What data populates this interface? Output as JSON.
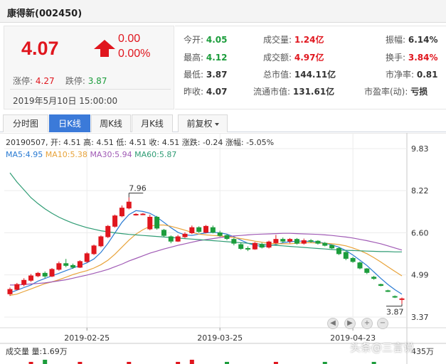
{
  "stock": {
    "title": "康得新(002450)"
  },
  "quote": {
    "price": "4.07",
    "change": "0.00",
    "change_pct": "0.00%",
    "limit_up_label": "涨停:",
    "limit_up": "4.27",
    "limit_down_label": "跌停:",
    "limit_down": "3.87",
    "datetime": "2019年5月10日 15:00:00"
  },
  "stats": [
    {
      "label": "今开:",
      "value": "4.05",
      "color": "green"
    },
    {
      "label": "成交量:",
      "value": "1.24亿",
      "color": "red"
    },
    {
      "label": "振幅:",
      "value": "6.14%",
      "color": "dark"
    },
    {
      "label": "最高:",
      "value": "4.12",
      "color": "green"
    },
    {
      "label": "成交额:",
      "value": "4.97亿",
      "color": "red"
    },
    {
      "label": "换手:",
      "value": "3.84%",
      "color": "red"
    },
    {
      "label": "最低:",
      "value": "3.87",
      "color": "dark"
    },
    {
      "label": "总市值:",
      "value": "144.11亿",
      "color": "dark"
    },
    {
      "label": "市净率:",
      "value": "0.81",
      "color": "dark"
    },
    {
      "label": "昨收:",
      "value": "4.07",
      "color": "dark"
    },
    {
      "label": "流通市值:",
      "value": "131.61亿",
      "color": "dark"
    },
    {
      "label": "市盈率(动):",
      "value": "亏损",
      "color": "dark"
    }
  ],
  "tabs": [
    {
      "label": "分时图",
      "active": false
    },
    {
      "label": "日K线",
      "active": true
    },
    {
      "label": "周K线",
      "active": false
    },
    {
      "label": "月K线",
      "active": false
    },
    {
      "label": "前复权",
      "active": false
    }
  ],
  "chart_info": {
    "line1": "20190507, 开: 4.51 高: 4.51 低: 4.51 收: 4.51 涨跌: -0.24 涨幅: -5.05%",
    "ma5": "MA5:4.95",
    "ma10": "MA10:5.38",
    "ma30": "MA30:5.94",
    "ma60": "MA60:5.87",
    "volume": "成交量 量:1.69万"
  },
  "watermark": "头条@三言说",
  "chart_data": {
    "type": "candlestick",
    "y_ticks": [
      "9.83",
      "8.22",
      "6.60",
      "4.99",
      "3.37"
    ],
    "y_range": [
      3.37,
      9.83
    ],
    "volume_tick": "435万",
    "x_labels": [
      {
        "label": "2019-02-25",
        "index": 11
      },
      {
        "label": "2019-03-25",
        "index": 30
      },
      {
        "label": "2019-04-23",
        "index": 49
      }
    ],
    "annotations": [
      {
        "text": "7.96",
        "index": 17,
        "value": 7.96
      },
      {
        "text": "3.87",
        "index": 56,
        "value": 3.87
      }
    ],
    "candles": [
      {
        "o": 4.26,
        "c": 4.43,
        "h": 4.5,
        "l": 4.18
      },
      {
        "o": 4.43,
        "c": 4.62,
        "h": 4.68,
        "l": 4.4
      },
      {
        "o": 4.62,
        "c": 4.78,
        "h": 4.86,
        "l": 4.55
      },
      {
        "o": 4.78,
        "c": 4.95,
        "h": 5.02,
        "l": 4.72
      },
      {
        "o": 4.95,
        "c": 5.05,
        "h": 5.1,
        "l": 4.9
      },
      {
        "o": 5.05,
        "c": 4.94,
        "h": 5.12,
        "l": 4.86
      },
      {
        "o": 4.94,
        "c": 5.2,
        "h": 5.25,
        "l": 4.9
      },
      {
        "o": 5.2,
        "c": 5.42,
        "h": 5.5,
        "l": 5.15
      },
      {
        "o": 5.42,
        "c": 5.35,
        "h": 5.6,
        "l": 5.28
      },
      {
        "o": 5.35,
        "c": 5.28,
        "h": 5.42,
        "l": 5.22
      },
      {
        "o": 5.28,
        "c": 5.5,
        "h": 5.55,
        "l": 5.25
      },
      {
        "o": 5.5,
        "c": 5.8,
        "h": 5.86,
        "l": 5.45
      },
      {
        "o": 5.8,
        "c": 6.1,
        "h": 6.15,
        "l": 5.75
      },
      {
        "o": 6.1,
        "c": 6.45,
        "h": 6.5,
        "l": 6.05
      },
      {
        "o": 6.45,
        "c": 6.85,
        "h": 6.9,
        "l": 6.4
      },
      {
        "o": 6.85,
        "c": 7.25,
        "h": 7.3,
        "l": 6.8
      },
      {
        "o": 7.25,
        "c": 7.55,
        "h": 7.65,
        "l": 7.2
      },
      {
        "o": 7.55,
        "c": 7.78,
        "h": 7.96,
        "l": 7.5
      },
      {
        "o": 7.3,
        "c": 7.31,
        "h": 7.35,
        "l": 7.26
      },
      {
        "o": 7.31,
        "c": 7.32,
        "h": 7.36,
        "l": 7.28
      },
      {
        "o": 6.75,
        "c": 7.2,
        "h": 7.3,
        "l": 6.7
      },
      {
        "o": 7.2,
        "c": 6.78,
        "h": 7.25,
        "l": 6.72
      },
      {
        "o": 6.7,
        "c": 6.5,
        "h": 6.75,
        "l": 6.45
      },
      {
        "o": 6.45,
        "c": 6.28,
        "h": 6.5,
        "l": 6.2
      },
      {
        "o": 6.28,
        "c": 6.45,
        "h": 6.52,
        "l": 6.25
      },
      {
        "o": 6.45,
        "c": 6.55,
        "h": 6.62,
        "l": 6.4
      },
      {
        "o": 6.6,
        "c": 6.8,
        "h": 6.88,
        "l": 6.55
      },
      {
        "o": 6.8,
        "c": 6.65,
        "h": 6.85,
        "l": 6.6
      },
      {
        "o": 6.62,
        "c": 6.85,
        "h": 6.9,
        "l": 6.58
      },
      {
        "o": 6.8,
        "c": 6.62,
        "h": 6.88,
        "l": 6.58
      },
      {
        "o": 6.6,
        "c": 6.5,
        "h": 6.68,
        "l": 6.45
      },
      {
        "o": 6.5,
        "c": 6.38,
        "h": 6.55,
        "l": 6.32
      },
      {
        "o": 6.35,
        "c": 6.2,
        "h": 6.4,
        "l": 6.12
      },
      {
        "o": 6.15,
        "c": 6.0,
        "h": 6.22,
        "l": 5.95
      },
      {
        "o": 6.0,
        "c": 5.98,
        "h": 6.08,
        "l": 5.9
      },
      {
        "o": 5.98,
        "c": 6.2,
        "h": 6.25,
        "l": 5.95
      },
      {
        "o": 6.15,
        "c": 6.05,
        "h": 6.22,
        "l": 6.0
      },
      {
        "o": 6.05,
        "c": 6.25,
        "h": 6.3,
        "l": 6.0
      },
      {
        "o": 6.22,
        "c": 6.35,
        "h": 6.52,
        "l": 6.18
      },
      {
        "o": 6.35,
        "c": 6.28,
        "h": 6.42,
        "l": 6.22
      },
      {
        "o": 6.28,
        "c": 6.35,
        "h": 6.4,
        "l": 6.2
      },
      {
        "o": 6.35,
        "c": 6.2,
        "h": 6.4,
        "l": 6.15
      },
      {
        "o": 6.2,
        "c": 6.3,
        "h": 6.38,
        "l": 6.15
      },
      {
        "o": 6.3,
        "c": 6.28,
        "h": 6.36,
        "l": 6.22
      },
      {
        "o": 6.28,
        "c": 6.2,
        "h": 6.32,
        "l": 6.15
      },
      {
        "o": 6.2,
        "c": 6.12,
        "h": 6.25,
        "l": 6.08
      },
      {
        "o": 6.12,
        "c": 6.02,
        "h": 6.15,
        "l": 5.98
      },
      {
        "o": 6.0,
        "c": 5.8,
        "h": 6.05,
        "l": 5.75
      },
      {
        "o": 5.85,
        "c": 5.62,
        "h": 5.9,
        "l": 5.55
      },
      {
        "o": 5.62,
        "c": 5.5,
        "h": 5.68,
        "l": 5.45
      },
      {
        "o": 5.45,
        "c": 5.25,
        "h": 5.5,
        "l": 5.2
      },
      {
        "o": 5.22,
        "c": 5.08,
        "h": 5.25,
        "l": 5.02
      },
      {
        "o": 4.9,
        "c": 4.85,
        "h": 4.95,
        "l": 4.8
      },
      {
        "o": 4.62,
        "c": 4.58,
        "h": 4.65,
        "l": 4.55
      },
      {
        "o": 4.38,
        "c": 4.36,
        "h": 4.42,
        "l": 4.33
      },
      {
        "o": 4.16,
        "c": 4.14,
        "h": 4.2,
        "l": 4.1
      },
      {
        "o": 4.05,
        "c": 4.07,
        "h": 4.12,
        "l": 3.87
      }
    ],
    "ma": [
      {
        "name": "MA5",
        "color": "#2a7bd3",
        "values": [
          4.3,
          4.4,
          4.5,
          4.6,
          4.75,
          4.85,
          4.95,
          5.05,
          5.15,
          5.25,
          5.35,
          5.45,
          5.6,
          5.85,
          6.2,
          6.6,
          7.0,
          7.3,
          7.45,
          7.42,
          7.35,
          7.2,
          7.0,
          6.8,
          6.62,
          6.52,
          6.5,
          6.55,
          6.6,
          6.62,
          6.6,
          6.55,
          6.45,
          6.32,
          6.2,
          6.12,
          6.08,
          6.1,
          6.15,
          6.22,
          6.26,
          6.28,
          6.28,
          6.27,
          6.25,
          6.2,
          6.14,
          6.05,
          5.92,
          5.75,
          5.55,
          5.35,
          5.1,
          4.85,
          4.62,
          4.42,
          4.25
        ]
      },
      {
        "name": "MA10",
        "color": "#e8a33a",
        "values": [
          4.2,
          4.25,
          4.35,
          4.45,
          4.55,
          4.65,
          4.72,
          4.8,
          4.9,
          5.0,
          5.08,
          5.15,
          5.25,
          5.38,
          5.55,
          5.78,
          6.05,
          6.32,
          6.55,
          6.72,
          6.85,
          6.9,
          6.9,
          6.85,
          6.78,
          6.7,
          6.62,
          6.55,
          6.52,
          6.5,
          6.48,
          6.45,
          6.42,
          6.38,
          6.33,
          6.28,
          6.24,
          6.2,
          6.18,
          6.18,
          6.18,
          6.2,
          6.22,
          6.22,
          6.21,
          6.2,
          6.18,
          6.15,
          6.1,
          6.02,
          5.92,
          5.8,
          5.65,
          5.48,
          5.3,
          5.12,
          4.95
        ]
      },
      {
        "name": "MA30",
        "color": "#a05ab5",
        "values": [
          4.6,
          4.6,
          4.62,
          4.64,
          4.66,
          4.68,
          4.72,
          4.76,
          4.8,
          4.86,
          4.92,
          4.98,
          5.05,
          5.12,
          5.2,
          5.3,
          5.4,
          5.52,
          5.62,
          5.72,
          5.82,
          5.9,
          5.98,
          6.05,
          6.12,
          6.18,
          6.24,
          6.3,
          6.34,
          6.38,
          6.42,
          6.45,
          6.48,
          6.5,
          6.52,
          6.54,
          6.55,
          6.56,
          6.57,
          6.58,
          6.58,
          6.57,
          6.56,
          6.55,
          6.54,
          6.52,
          6.5,
          6.47,
          6.44,
          6.4,
          6.35,
          6.3,
          6.24,
          6.18,
          6.1,
          6.02,
          5.94
        ]
      },
      {
        "name": "MA60",
        "color": "#2f9c74",
        "values": [
          8.9,
          8.55,
          8.25,
          7.95,
          7.72,
          7.52,
          7.35,
          7.2,
          7.08,
          6.97,
          6.88,
          6.8,
          6.74,
          6.68,
          6.64,
          6.6,
          6.57,
          6.54,
          6.52,
          6.5,
          6.48,
          6.46,
          6.44,
          6.42,
          6.4,
          6.38,
          6.36,
          6.34,
          6.32,
          6.3,
          6.28,
          6.26,
          6.24,
          6.22,
          6.2,
          6.18,
          6.16,
          6.14,
          6.12,
          6.1,
          6.08,
          6.06,
          6.04,
          6.02,
          6.0,
          5.98,
          5.96,
          5.94,
          5.93,
          5.92,
          5.91,
          5.9,
          5.89,
          5.88,
          5.88,
          5.87,
          5.87
        ]
      }
    ]
  }
}
